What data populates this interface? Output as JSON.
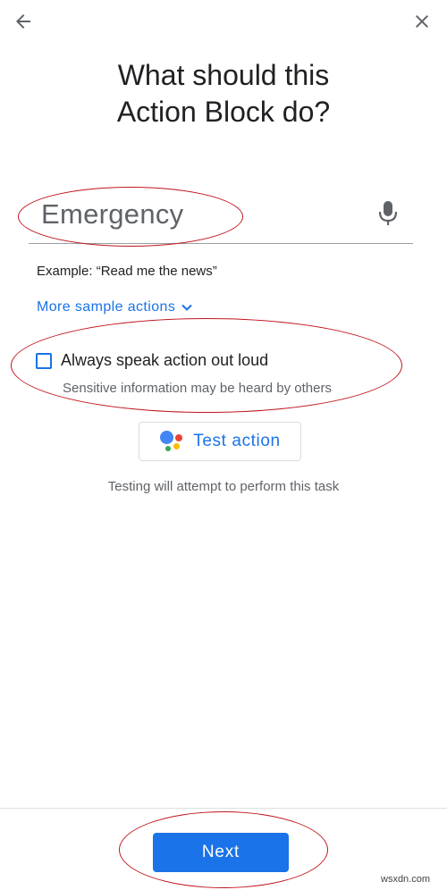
{
  "header": {
    "back_icon": "arrow-back-icon",
    "close_icon": "close-icon",
    "title_line1": "What should this",
    "title_line2": "Action Block do?"
  },
  "input": {
    "value": "Emergency",
    "mic_icon": "mic-icon"
  },
  "example_text": "Example: “Read me the news”",
  "more_actions": {
    "label": "More sample actions",
    "icon": "chevron-down-icon"
  },
  "speak_option": {
    "label": "Always speak action out loud",
    "sublabel": "Sensitive information may be heard by others",
    "checked": false
  },
  "test_action": {
    "label": "Test action",
    "icon": "google-assistant-icon",
    "hint": "Testing will attempt to perform this task"
  },
  "footer": {
    "next_label": "Next"
  },
  "watermark": "wsxdn.com",
  "colors": {
    "accent": "#1a73e8",
    "annotation": "#c0151e"
  }
}
